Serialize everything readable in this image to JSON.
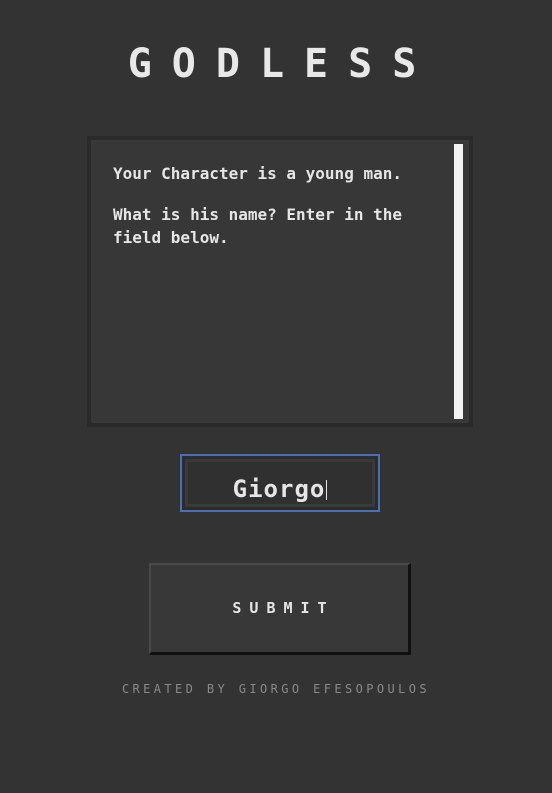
{
  "app": {
    "title": "GODLESS"
  },
  "story": {
    "paragraphs": [
      "Your Character is a young man.",
      "What is his name? Enter in the field below."
    ]
  },
  "name_field": {
    "value": "Giorgo"
  },
  "submit": {
    "label": "SUBMIT"
  },
  "footer": {
    "credit": "CREATED BY GIORGO EFESOPOULOS"
  },
  "colors": {
    "background": "#333333",
    "text": "#e6e6e6",
    "input_focus_border": "#4a6fb5",
    "credit_text": "#8a8a8a"
  }
}
